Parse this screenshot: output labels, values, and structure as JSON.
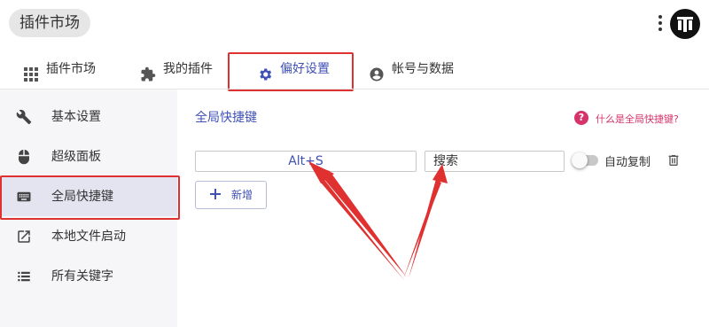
{
  "header": {
    "app_title": "插件市场",
    "more_icon": "more-vert-icon",
    "logo_icon": "app-logo-icon"
  },
  "tabs": [
    {
      "label": "插件市场",
      "icon": "apps-grid-icon",
      "active": false
    },
    {
      "label": "我的插件",
      "icon": "puzzle-icon",
      "active": false
    },
    {
      "label": "偏好设置",
      "icon": "gear-icon",
      "active": true
    },
    {
      "label": "帐号与数据",
      "icon": "account-circle-icon",
      "active": false
    }
  ],
  "sidebar": {
    "items": [
      {
        "label": "基本设置",
        "icon": "wrench-icon",
        "active": false
      },
      {
        "label": "超级面板",
        "icon": "mouse-icon",
        "active": false
      },
      {
        "label": "全局快捷键",
        "icon": "keyboard-icon",
        "active": true
      },
      {
        "label": "本地文件启动",
        "icon": "open-external-icon",
        "active": false
      },
      {
        "label": "所有关键字",
        "icon": "list-icon",
        "active": false
      }
    ]
  },
  "main": {
    "section_title": "全局快捷键",
    "help_link": "什么是全局快捷键?",
    "shortcut_row": {
      "hotkey": "Alt+S",
      "keyword": "搜索",
      "auto_copy_label": "自动复制",
      "auto_copy_enabled": false
    },
    "add_button_label": "新增"
  },
  "colors": {
    "accent": "#3f51b5",
    "highlight_red": "#e03131",
    "help_pink": "#d6336c",
    "sidebar_bg": "#f6f6f8"
  }
}
